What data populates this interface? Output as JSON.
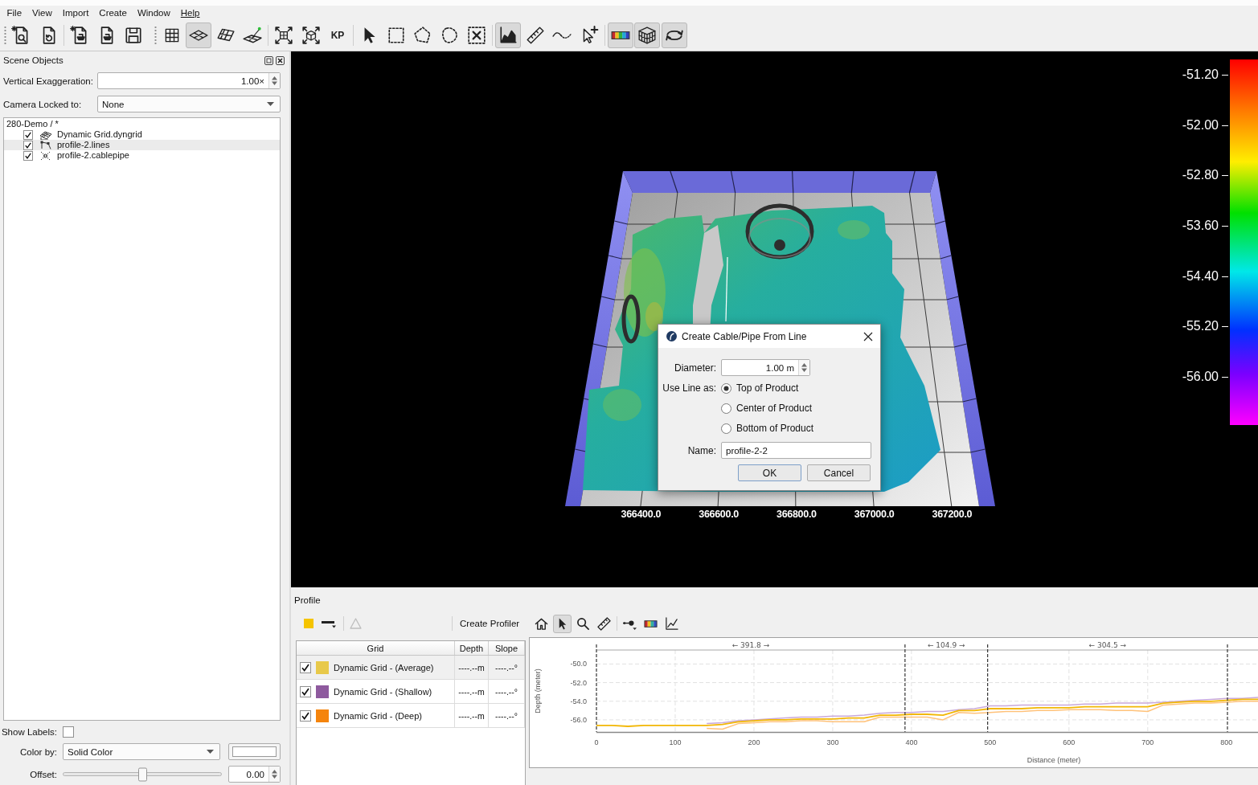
{
  "menu": [
    {
      "label": "File",
      "underlined": false
    },
    {
      "label": "View",
      "underlined": false
    },
    {
      "label": "Import",
      "underlined": false
    },
    {
      "label": "Create",
      "underlined": false
    },
    {
      "label": "Window",
      "underlined": false
    },
    {
      "label": "Help",
      "underlined": true
    }
  ],
  "toolbar": {
    "groups": [
      {
        "handle": true,
        "buttons": [
          {
            "pressed": false
          },
          {
            "pressed": false
          }
        ]
      },
      {
        "handle": false,
        "buttons": [
          {
            "pressed": false
          },
          {
            "pressed": false
          },
          {
            "pressed": false
          }
        ]
      },
      {
        "handle": true,
        "buttons": [
          {
            "pressed": false
          },
          {
            "pressed": true
          },
          {
            "pressed": false
          },
          {
            "pressed": false
          }
        ]
      },
      {
        "handle": false,
        "buttons": [
          {
            "pressed": false
          },
          {
            "pressed": false
          },
          {
            "label": "KP",
            "pressed": false
          }
        ]
      },
      {
        "handle": false,
        "buttons": [
          {
            "pressed": false
          },
          {
            "pressed": false
          },
          {
            "pressed": false
          },
          {
            "pressed": false
          },
          {
            "pressed": false
          }
        ]
      },
      {
        "handle": false,
        "buttons": [
          {
            "pressed": true
          },
          {
            "pressed": false
          },
          {
            "pressed": false
          },
          {
            "pressed": false
          }
        ]
      },
      {
        "handle": false,
        "buttons": [
          {
            "pressed": true
          },
          {
            "pressed": true
          },
          {
            "pressed": true
          }
        ]
      }
    ]
  },
  "scene_panel": {
    "title": "Scene Objects",
    "vertical_exaggeration": {
      "label": "Vertical Exaggeration:",
      "value": "1.00×"
    },
    "camera_lock": {
      "label": "Camera Locked to:",
      "value": "None"
    },
    "tree": {
      "label": "280-Demo / *",
      "selected": false,
      "children": [
        {
          "label": "Dynamic Grid.dyngrid",
          "kind": "grid",
          "checked": true,
          "selected": false
        },
        {
          "label": "profile-2.lines",
          "kind": "lines",
          "checked": true,
          "selected": true
        },
        {
          "label": "profile-2.cablepipe",
          "kind": "cablepipe",
          "checked": true,
          "selected": false
        }
      ]
    },
    "show_labels": {
      "label": "Show Labels:",
      "checked": false
    },
    "color_by": {
      "label": "Color by:",
      "value": "Solid Color"
    },
    "offset": {
      "label": "Offset:",
      "level": 0.5,
      "value": "0.00"
    }
  },
  "viewport": {
    "axis_labels": [
      "366400.0",
      "366600.0",
      "366800.0",
      "367000.0",
      "367200.0"
    ],
    "color_scale": [
      "-51.20",
      "-52.00",
      "-52.80",
      "-53.60",
      "-54.40",
      "-55.20",
      "-56.00"
    ]
  },
  "dialog": {
    "title": "Create Cable/Pipe From Line",
    "diameter": {
      "label": "Diameter:",
      "value": "1.00 m"
    },
    "use_line_as": {
      "label": "Use Line as:",
      "options": [
        {
          "label": "Top of Product",
          "selected": true
        },
        {
          "label": "Center of Product",
          "selected": false
        },
        {
          "label": "Bottom of Product",
          "selected": false
        }
      ]
    },
    "name": {
      "label": "Name:",
      "value": "profile-2-2"
    },
    "buttons": [
      {
        "label": "OK",
        "default": true
      },
      {
        "label": "Cancel",
        "default": false
      }
    ]
  },
  "profile": {
    "title": "Profile",
    "style_tools": [
      {
        "disabled": false
      },
      {
        "disabled": false
      },
      {
        "disabled": true
      }
    ],
    "create_button": "Create Profiler",
    "tool_groups": [
      [
        {
          "pressed": false
        },
        {
          "pressed": true
        },
        {
          "pressed": false
        },
        {
          "pressed": false
        }
      ],
      [
        {
          "pressed": false
        },
        {
          "pressed": false
        },
        {
          "pressed": false
        }
      ]
    ],
    "grid_table": {
      "columns": [
        "Grid",
        "Depth",
        "Slope"
      ],
      "rows": [
        {
          "name": "Dynamic Grid - (Average)",
          "color": "#e8c94a",
          "checked": true,
          "selected": true,
          "depth": "----.--m",
          "slope": "----.--°"
        },
        {
          "name": "Dynamic Grid - (Shallow)",
          "color": "#8e5a9e",
          "checked": true,
          "selected": false,
          "depth": "----.--m",
          "slope": "----.--°"
        },
        {
          "name": "Dynamic Grid - (Deep)",
          "color": "#f5840c",
          "checked": true,
          "selected": false,
          "depth": "----.--m",
          "slope": "----.--°"
        }
      ]
    },
    "chart": {
      "chart_data": {
        "type": "line",
        "xlabel": "Distance (meter)",
        "ylabel": "Depth (meter)",
        "grid": true,
        "x": [
          0,
          20,
          40,
          60,
          80,
          100,
          120,
          140,
          160,
          180,
          200,
          220,
          240,
          260,
          280,
          300,
          320,
          340,
          360,
          380,
          400,
          420,
          440,
          460,
          480,
          500,
          520,
          540,
          560,
          580,
          600,
          620,
          640,
          660,
          680,
          700,
          720,
          740,
          760,
          780,
          800,
          820,
          840
        ],
        "series": [
          {
            "color": "#c9a9d9",
            "values": [
              null,
              null,
              null,
              null,
              null,
              null,
              null,
              -56.4,
              -56.3,
              -56.1,
              -56.0,
              -55.9,
              -55.8,
              -55.7,
              -55.7,
              -55.6,
              -55.6,
              -55.5,
              -55.3,
              -55.2,
              -55.2,
              -55.1,
              -55.1,
              -54.9,
              -54.8,
              -54.5,
              -54.5,
              -54.4,
              -54.4,
              -54.4,
              -54.4,
              -54.3,
              -54.3,
              -54.2,
              -54.2,
              -54.2,
              -54.1,
              -54.0,
              -53.9,
              -53.8,
              -53.7,
              -53.7,
              -53.6
            ]
          },
          {
            "color": "#ffc27a",
            "values": [
              null,
              null,
              null,
              null,
              null,
              null,
              null,
              -56.9,
              -57.0,
              -56.4,
              -56.3,
              -56.2,
              -56.2,
              -56.1,
              -56.1,
              -56.2,
              -56.2,
              -56.2,
              -55.7,
              -55.7,
              -55.7,
              -55.7,
              -56.0,
              -55.2,
              -55.3,
              -55.2,
              -55.1,
              -55.1,
              -55.0,
              -55.0,
              -54.9,
              -54.9,
              -54.9,
              -55.0,
              -55.0,
              -55.1,
              -54.4,
              -54.3,
              -54.2,
              -54.2,
              -54.1,
              -54.0,
              -54.0
            ]
          },
          {
            "color": "#f2b705",
            "values": [
              -56.6,
              -56.6,
              -56.7,
              -56.6,
              -56.6,
              -56.6,
              -56.6,
              -56.6,
              -56.5,
              -56.2,
              -56.1,
              -56.0,
              -56.0,
              -55.9,
              -55.9,
              -55.9,
              -55.8,
              -55.8,
              -55.5,
              -55.5,
              -55.4,
              -55.4,
              -55.5,
              -55.0,
              -55.0,
              -54.8,
              -54.8,
              -54.8,
              -54.7,
              -54.7,
              -54.7,
              -54.6,
              -54.6,
              -54.6,
              -54.6,
              -54.6,
              -54.2,
              -54.1,
              -54.0,
              -54.0,
              -53.9,
              -53.8,
              -53.8
            ]
          }
        ],
        "xlim": [
          0,
          840
        ],
        "ylim": [
          -57.3,
          -48.5
        ],
        "xticks": [
          0,
          100,
          200,
          300,
          400,
          500,
          600,
          700,
          800
        ],
        "yticks": [
          {
            "value": -50,
            "label": "-50.0"
          },
          {
            "value": -52,
            "label": "-52.0"
          },
          {
            "value": -54,
            "label": "-54.0"
          },
          {
            "value": -56,
            "label": "-56.0"
          }
        ],
        "ref_lines": [
          {
            "axis": "x",
            "value": 0
          },
          {
            "axis": "x",
            "value": 391.8
          },
          {
            "axis": "x",
            "value": 496.7
          },
          {
            "axis": "x",
            "value": 801.2
          }
        ],
        "annotations": [
          "← 391.8 →",
          "← 104.9 →",
          "← 304.5 →"
        ]
      }
    }
  }
}
